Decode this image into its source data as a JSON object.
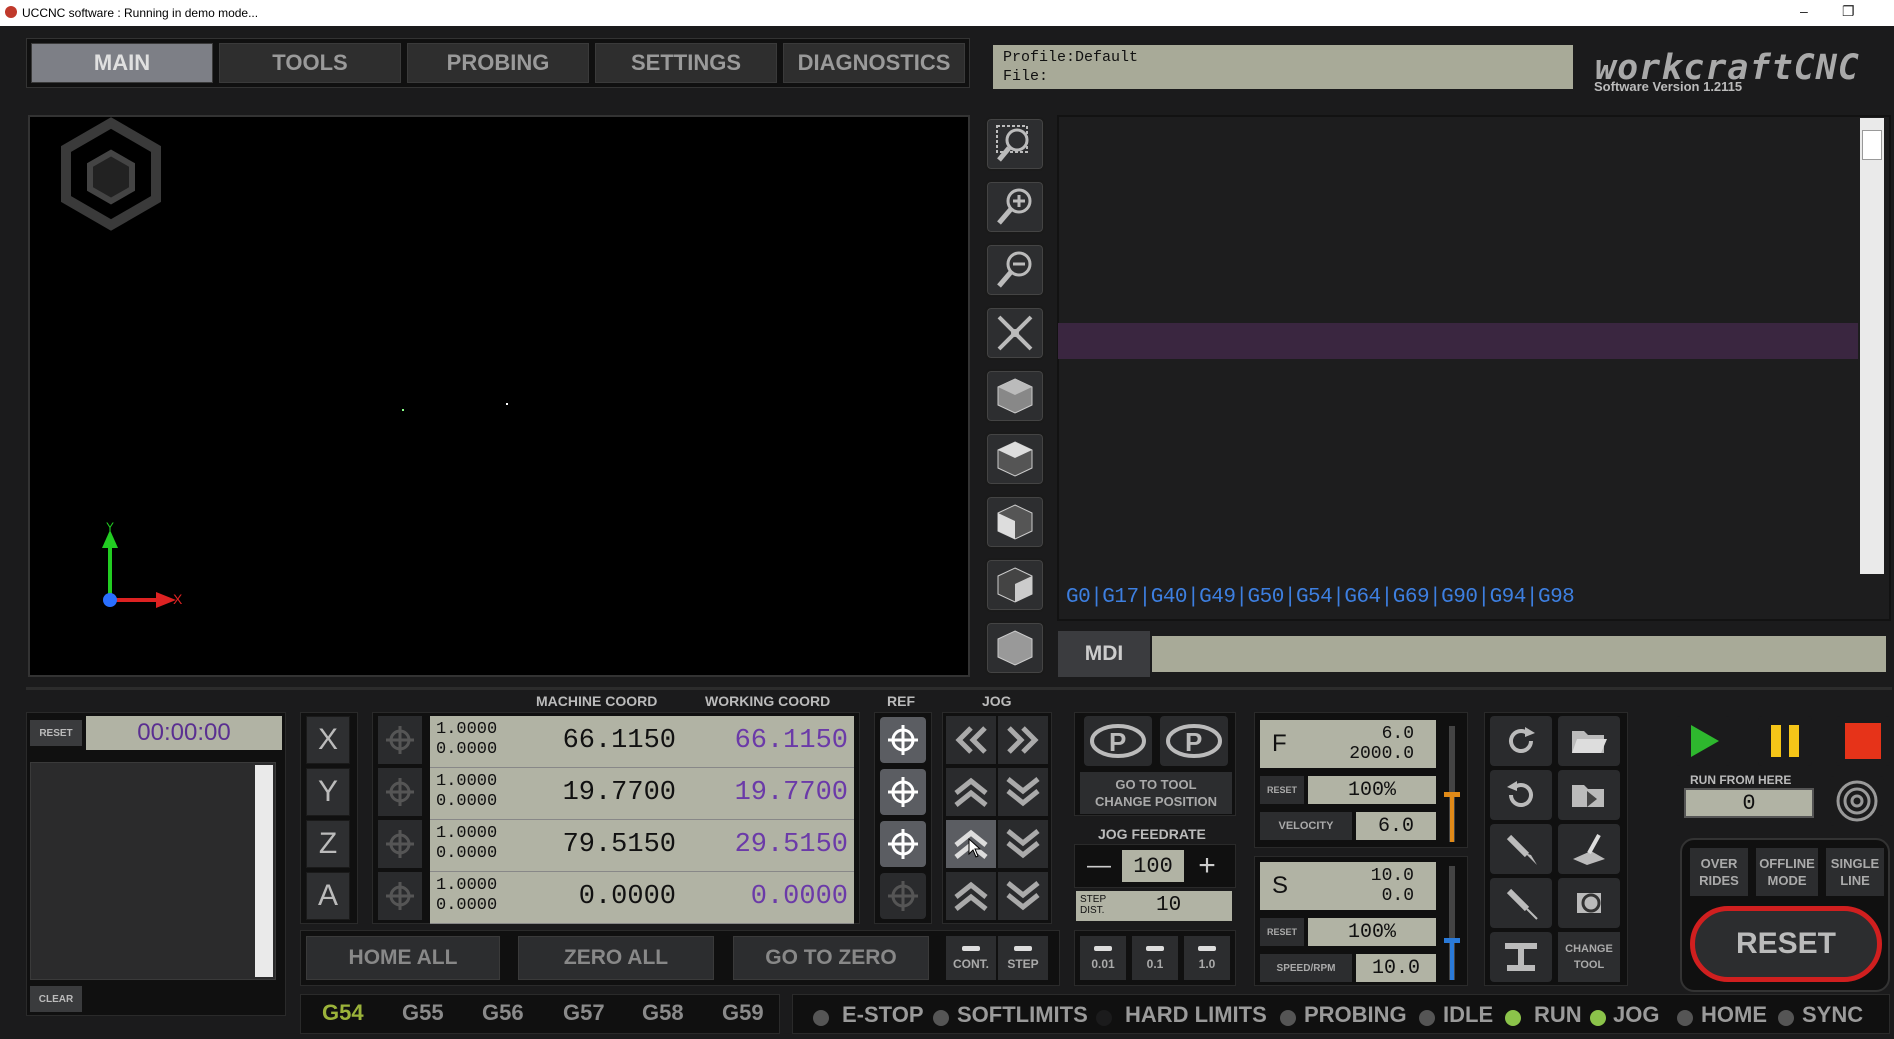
{
  "window": {
    "title": "UCCNC software : Running in demo mode...",
    "minimize": "–",
    "restore": "❐"
  },
  "tabs": [
    "MAIN",
    "TOOLS",
    "PROBING",
    "SETTINGS",
    "DIAGNOSTICS"
  ],
  "profile": {
    "profile_line": "Profile:Default",
    "file_line": "File:"
  },
  "brand": {
    "logo": "workcraftCNC",
    "version": "Software Version 1.2115"
  },
  "viewport": {
    "axis_y": "Y",
    "axis_x": "X"
  },
  "view_buttons": [
    "zoom-region-icon",
    "zoom-in-icon",
    "zoom-out-icon",
    "fit-icon",
    "view-iso-icon",
    "view-top-icon",
    "view-front-icon",
    "view-side-icon",
    "view-cube-icon"
  ],
  "modal_codes": "G0|G17|G40|G49|G50|G54|G64|G69|G90|G94|G98",
  "mdi": {
    "label": "MDI",
    "value": ""
  },
  "timer": {
    "reset_label": "RESET",
    "time": "00:00:00",
    "clear_label": "CLEAR"
  },
  "headers": {
    "machine": "MACHINE COORD",
    "working": "WORKING COORD",
    "ref": "REF",
    "jog": "JOG"
  },
  "axes": [
    {
      "name": "X",
      "scale": "1.0000",
      "offset": "0.0000",
      "machine": "66.1150",
      "working": "66.1150"
    },
    {
      "name": "Y",
      "scale": "1.0000",
      "offset": "0.0000",
      "machine": "19.7700",
      "working": "19.7700"
    },
    {
      "name": "Z",
      "scale": "1.0000",
      "offset": "0.0000",
      "machine": "79.5150",
      "working": "29.5150"
    },
    {
      "name": "A",
      "scale": "1.0000",
      "offset": "0.0000",
      "machine": "0.0000",
      "working": "0.0000"
    }
  ],
  "bottom_buttons": {
    "home_all": "HOME ALL",
    "zero_all": "ZERO ALL",
    "go_to_zero": "GO TO ZERO"
  },
  "jog_modes": {
    "cont": "CONT.",
    "step": "STEP"
  },
  "tool_change": {
    "label_1": "GO TO TOOL",
    "label_2": "CHANGE POSITION"
  },
  "jog_feedrate": {
    "label": "JOG FEEDRATE",
    "minus": "—",
    "value": "100",
    "plus": "+",
    "step_label_1": "STEP",
    "step_label_2": "DIST.",
    "step_value": "10"
  },
  "step_sizes": [
    "0.01",
    "0.1",
    "1.0"
  ],
  "feed": {
    "letter": "F",
    "line1": "6.0",
    "line2": "2000.0",
    "reset": "RESET",
    "override": "100%",
    "velocity_label": "VELOCITY",
    "velocity": "6.0"
  },
  "spindle": {
    "letter": "S",
    "line1": "10.0",
    "line2": "0.0",
    "reset": "RESET",
    "override": "100%",
    "speed_label": "SPEED/RPM",
    "speed": "10.0"
  },
  "change_tool": {
    "line1": "CHANGE",
    "line2": "TOOL"
  },
  "run": {
    "run_from_here_label": "RUN FROM HERE",
    "run_from_here_value": "0"
  },
  "mode_buttons": [
    {
      "l1": "OVER",
      "l2": "RIDES"
    },
    {
      "l1": "OFFLINE",
      "l2": "MODE"
    },
    {
      "l1": "SINGLE",
      "l2": "LINE"
    }
  ],
  "reset_big": "RESET",
  "work_offsets": [
    "G54",
    "G55",
    "G56",
    "G57",
    "G58",
    "G59"
  ],
  "status": [
    "E-STOP",
    "SOFTLIMITS",
    "HARD LIMITS",
    "PROBING",
    "IDLE",
    "RUN",
    "JOG",
    "HOME",
    "SYNC"
  ],
  "colors": {
    "green_led": "#8bc34a",
    "active_offset": "#9bb33a",
    "play": "#2eb82e",
    "pause": "#f5c518",
    "stop": "#e63319",
    "reset_ring": "#d01f1f"
  }
}
